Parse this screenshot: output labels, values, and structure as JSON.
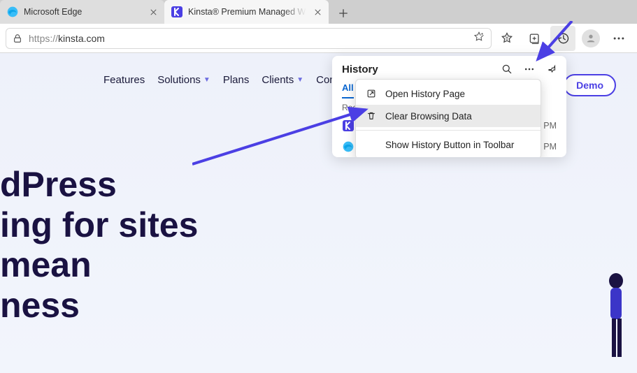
{
  "tabs": [
    {
      "title": "Microsoft Edge"
    },
    {
      "title": "Kinsta® Premium Managed Wo"
    }
  ],
  "address": {
    "protocol": "https://",
    "host": "kinsta.com"
  },
  "nav": {
    "items": [
      "Features",
      "Solutions",
      "Plans",
      "Clients",
      "Contac"
    ]
  },
  "demo_label": "Demo",
  "hero_lines": [
    "dPress",
    "ing for sites",
    " mean",
    "ness"
  ],
  "history": {
    "title": "History",
    "tabs": [
      "All"
    ],
    "section": "Rec",
    "rows": [
      {
        "label": "K",
        "time": "20 PM"
      },
      {
        "label": "Microsoft Edge",
        "time": "12:19 PM"
      }
    ],
    "menu": {
      "open_page": "Open History Page",
      "clear_data": "Clear Browsing Data",
      "show_button": "Show History Button in Toolbar"
    }
  }
}
